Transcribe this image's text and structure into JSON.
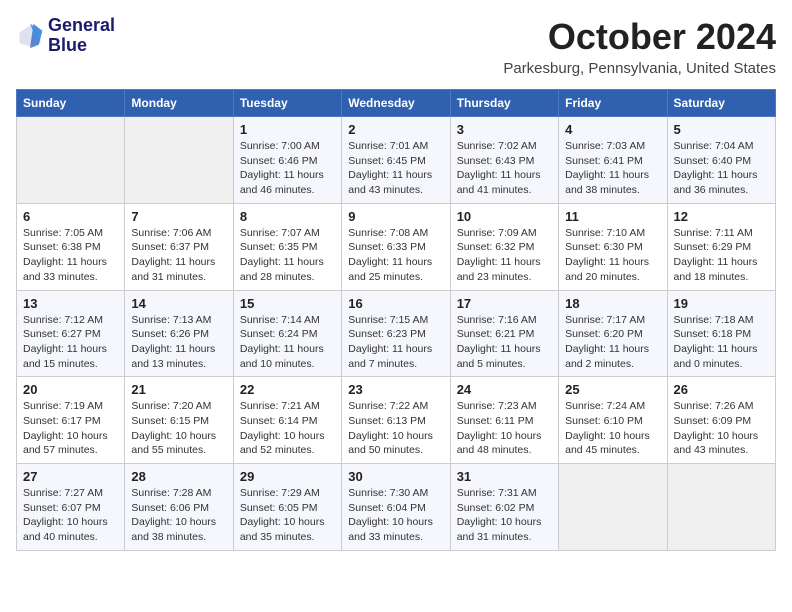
{
  "header": {
    "logo_line1": "General",
    "logo_line2": "Blue",
    "month_title": "October 2024",
    "location": "Parkesburg, Pennsylvania, United States"
  },
  "weekdays": [
    "Sunday",
    "Monday",
    "Tuesday",
    "Wednesday",
    "Thursday",
    "Friday",
    "Saturday"
  ],
  "weeks": [
    [
      {
        "day": "",
        "info": ""
      },
      {
        "day": "",
        "info": ""
      },
      {
        "day": "1",
        "info": "Sunrise: 7:00 AM\nSunset: 6:46 PM\nDaylight: 11 hours and 46 minutes."
      },
      {
        "day": "2",
        "info": "Sunrise: 7:01 AM\nSunset: 6:45 PM\nDaylight: 11 hours and 43 minutes."
      },
      {
        "day": "3",
        "info": "Sunrise: 7:02 AM\nSunset: 6:43 PM\nDaylight: 11 hours and 41 minutes."
      },
      {
        "day": "4",
        "info": "Sunrise: 7:03 AM\nSunset: 6:41 PM\nDaylight: 11 hours and 38 minutes."
      },
      {
        "day": "5",
        "info": "Sunrise: 7:04 AM\nSunset: 6:40 PM\nDaylight: 11 hours and 36 minutes."
      }
    ],
    [
      {
        "day": "6",
        "info": "Sunrise: 7:05 AM\nSunset: 6:38 PM\nDaylight: 11 hours and 33 minutes."
      },
      {
        "day": "7",
        "info": "Sunrise: 7:06 AM\nSunset: 6:37 PM\nDaylight: 11 hours and 31 minutes."
      },
      {
        "day": "8",
        "info": "Sunrise: 7:07 AM\nSunset: 6:35 PM\nDaylight: 11 hours and 28 minutes."
      },
      {
        "day": "9",
        "info": "Sunrise: 7:08 AM\nSunset: 6:33 PM\nDaylight: 11 hours and 25 minutes."
      },
      {
        "day": "10",
        "info": "Sunrise: 7:09 AM\nSunset: 6:32 PM\nDaylight: 11 hours and 23 minutes."
      },
      {
        "day": "11",
        "info": "Sunrise: 7:10 AM\nSunset: 6:30 PM\nDaylight: 11 hours and 20 minutes."
      },
      {
        "day": "12",
        "info": "Sunrise: 7:11 AM\nSunset: 6:29 PM\nDaylight: 11 hours and 18 minutes."
      }
    ],
    [
      {
        "day": "13",
        "info": "Sunrise: 7:12 AM\nSunset: 6:27 PM\nDaylight: 11 hours and 15 minutes."
      },
      {
        "day": "14",
        "info": "Sunrise: 7:13 AM\nSunset: 6:26 PM\nDaylight: 11 hours and 13 minutes."
      },
      {
        "day": "15",
        "info": "Sunrise: 7:14 AM\nSunset: 6:24 PM\nDaylight: 11 hours and 10 minutes."
      },
      {
        "day": "16",
        "info": "Sunrise: 7:15 AM\nSunset: 6:23 PM\nDaylight: 11 hours and 7 minutes."
      },
      {
        "day": "17",
        "info": "Sunrise: 7:16 AM\nSunset: 6:21 PM\nDaylight: 11 hours and 5 minutes."
      },
      {
        "day": "18",
        "info": "Sunrise: 7:17 AM\nSunset: 6:20 PM\nDaylight: 11 hours and 2 minutes."
      },
      {
        "day": "19",
        "info": "Sunrise: 7:18 AM\nSunset: 6:18 PM\nDaylight: 11 hours and 0 minutes."
      }
    ],
    [
      {
        "day": "20",
        "info": "Sunrise: 7:19 AM\nSunset: 6:17 PM\nDaylight: 10 hours and 57 minutes."
      },
      {
        "day": "21",
        "info": "Sunrise: 7:20 AM\nSunset: 6:15 PM\nDaylight: 10 hours and 55 minutes."
      },
      {
        "day": "22",
        "info": "Sunrise: 7:21 AM\nSunset: 6:14 PM\nDaylight: 10 hours and 52 minutes."
      },
      {
        "day": "23",
        "info": "Sunrise: 7:22 AM\nSunset: 6:13 PM\nDaylight: 10 hours and 50 minutes."
      },
      {
        "day": "24",
        "info": "Sunrise: 7:23 AM\nSunset: 6:11 PM\nDaylight: 10 hours and 48 minutes."
      },
      {
        "day": "25",
        "info": "Sunrise: 7:24 AM\nSunset: 6:10 PM\nDaylight: 10 hours and 45 minutes."
      },
      {
        "day": "26",
        "info": "Sunrise: 7:26 AM\nSunset: 6:09 PM\nDaylight: 10 hours and 43 minutes."
      }
    ],
    [
      {
        "day": "27",
        "info": "Sunrise: 7:27 AM\nSunset: 6:07 PM\nDaylight: 10 hours and 40 minutes."
      },
      {
        "day": "28",
        "info": "Sunrise: 7:28 AM\nSunset: 6:06 PM\nDaylight: 10 hours and 38 minutes."
      },
      {
        "day": "29",
        "info": "Sunrise: 7:29 AM\nSunset: 6:05 PM\nDaylight: 10 hours and 35 minutes."
      },
      {
        "day": "30",
        "info": "Sunrise: 7:30 AM\nSunset: 6:04 PM\nDaylight: 10 hours and 33 minutes."
      },
      {
        "day": "31",
        "info": "Sunrise: 7:31 AM\nSunset: 6:02 PM\nDaylight: 10 hours and 31 minutes."
      },
      {
        "day": "",
        "info": ""
      },
      {
        "day": "",
        "info": ""
      }
    ]
  ]
}
